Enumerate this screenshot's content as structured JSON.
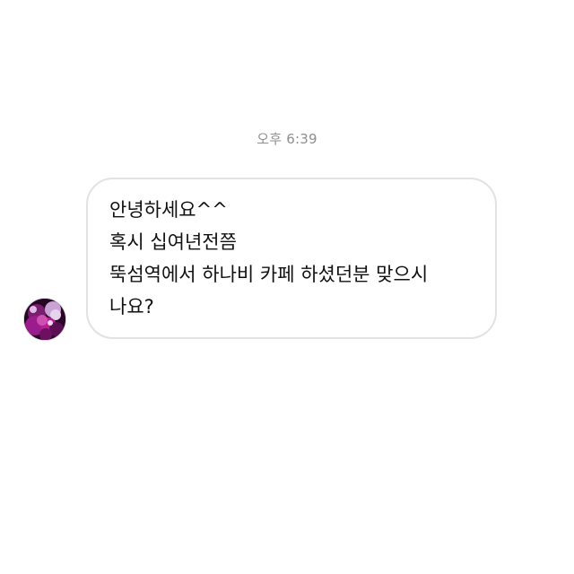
{
  "conversation": {
    "timestamp": "오후 6:39",
    "message": {
      "lines": [
        "안녕하세요^^",
        "혹시 십여년전쯤",
        "뚝섬역에서 하나비 카페 하셨던분 맞으시",
        "나요?"
      ]
    },
    "sender": {
      "avatar_icon": "flower-avatar-icon"
    }
  },
  "colors": {
    "timestamp": "#8e8e8e",
    "bubble_border": "#e2e2e2",
    "text": "#111111",
    "avatar_purple": "#8b1a7e"
  }
}
